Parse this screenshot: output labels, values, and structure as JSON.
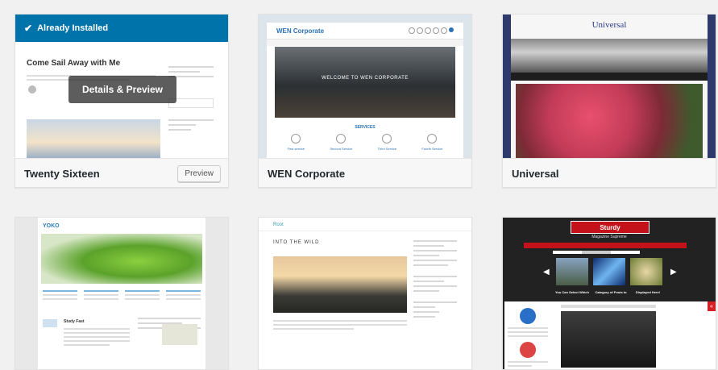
{
  "themes": [
    {
      "name": "Twenty Sixteen",
      "installed_label": "Already Installed",
      "overlay_label": "Details & Preview",
      "preview_button": "Preview",
      "post_title": "Come Sail Away with Me"
    },
    {
      "name": "WEN Corporate",
      "site_title": "WEN Corporate",
      "hero_text": "WELCOME TO WEN CORPORATE",
      "services_label": "SERVICES",
      "service_items": [
        "First service",
        "Second Service",
        "Third Service",
        "Fourth Service"
      ]
    },
    {
      "name": "Universal",
      "site_title": "Universal"
    },
    {
      "name": "YOKO",
      "site_title": "YOKO",
      "post_title": "Study Fast"
    },
    {
      "name": "Root",
      "site_title": "Root",
      "post_title": "INTO THE WILD"
    },
    {
      "name": "Sturdy",
      "site_title": "Sturdy",
      "subtitle": "Magazine Supreme",
      "captions": [
        "You Can Select Which",
        "Category of Posts to",
        "Displayed Here!"
      ]
    }
  ],
  "colors": {
    "accent": "#0073aa",
    "sturdy_red": "#c4121a"
  }
}
